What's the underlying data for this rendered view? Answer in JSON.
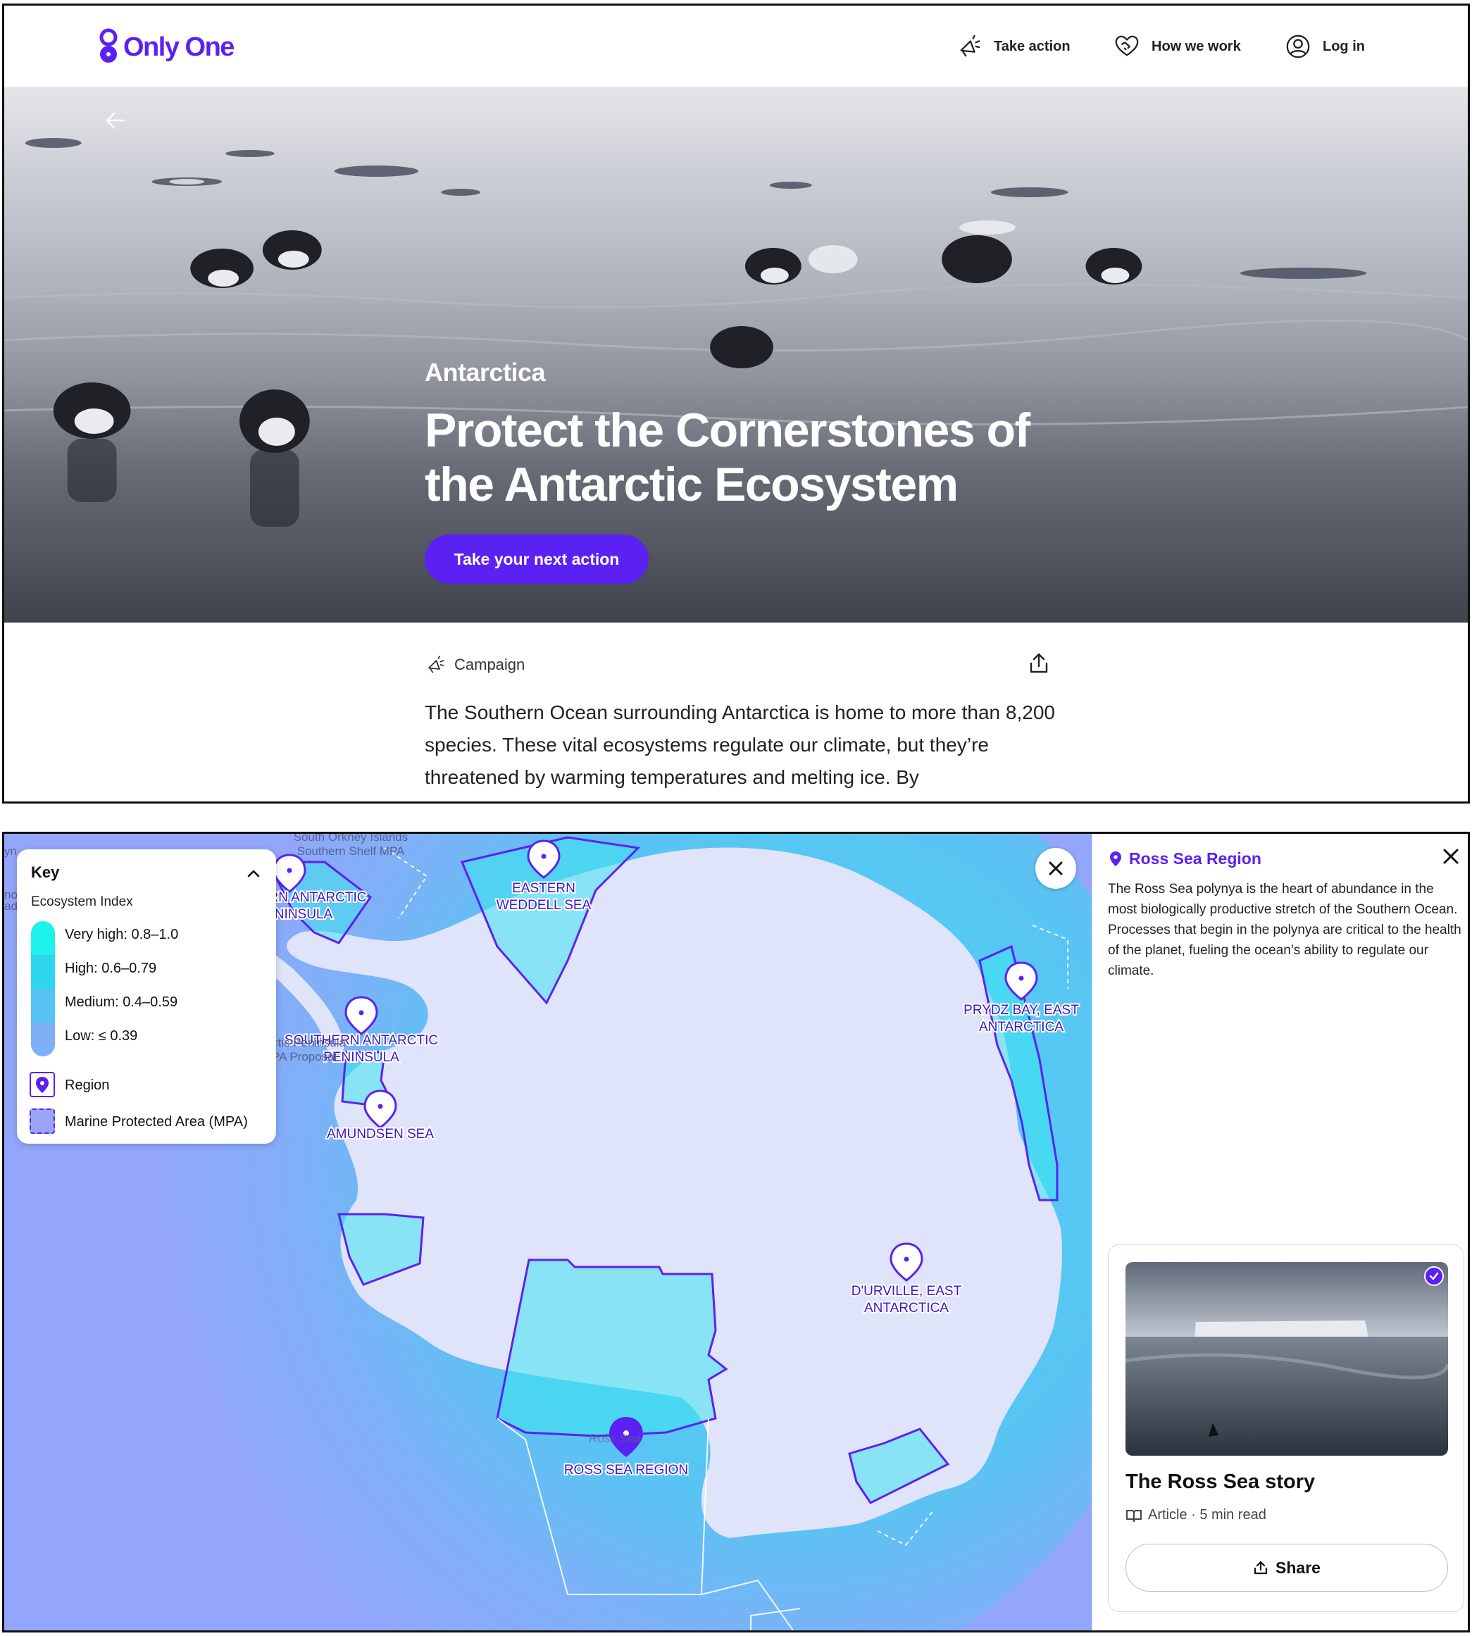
{
  "brand": {
    "name": "Only One",
    "accent": "#5b21f2"
  },
  "nav": {
    "take_action": "Take action",
    "how_we_work": "How we work",
    "log_in": "Log in"
  },
  "hero": {
    "eyebrow": "Antarctica",
    "title": "Protect the Cornerstones of the Antarctic Ecosystem",
    "cta": "Take your next action"
  },
  "content": {
    "tag": "Campaign",
    "intro": "The Southern Ocean surrounding Antarctica is home to more than 8,200 species. These vital ecosystems regulate our climate, but they’re threatened by warming temperatures and melting ice. By"
  },
  "map": {
    "legend": {
      "title": "Key",
      "subtitle": "Ecosystem Index",
      "levels": [
        {
          "label": "Very high: 0.8–1.0",
          "color": "#1ef0ec"
        },
        {
          "label": "High: 0.6–0.79",
          "color": "#2fd6f0"
        },
        {
          "label": "Medium: 0.4–0.59",
          "color": "#55c3f5"
        },
        {
          "label": "Low: ≤ 0.39",
          "color": "#7eb0f8"
        }
      ],
      "region": "Region",
      "mpa": "Marine Protected Area (MPA)"
    },
    "regions": {
      "ross": "ROSS SEA REGION",
      "amundsen": "AMUNDSEN SEA",
      "south_peninsula_1": "SOUTHERN ANTARCTIC",
      "south_peninsula_2": "PENINSULA",
      "north_peninsula_1": "RN ANTARCTIC",
      "north_peninsula_2": "NINSULA",
      "weddell_1": "EASTERN",
      "weddell_2": "WEDDELL SEA",
      "prydz_1": "PRYDZ BAY, EAST",
      "prydz_2": "ANTARCTICA",
      "durville_1": "D'URVILLE, EAST",
      "durville_2": "ANTARCTICA"
    },
    "faint_labels": {
      "orkney_1": "South Orkney Islands",
      "orkney_2": "Southern Shelf MPA",
      "peninsula_1": "ctic Peninsula",
      "peninsula_2": "PA Proposal",
      "ross_faint": "Ross Sea",
      "edge_1": "yn",
      "edge_2": "no",
      "edge_3": "ad"
    }
  },
  "side_panel": {
    "region_title": "Ross Sea Region",
    "description": "The Ross Sea polynya is the heart of abundance in the most biologically productive stretch of the Southern Ocean. Processes that begin in the polynya are critical to the health of the planet, fueling the ocean’s ability to regulate our climate.",
    "story": {
      "title": "The Ross Sea story",
      "meta": "Article · 5 min read",
      "share": "Share"
    }
  }
}
